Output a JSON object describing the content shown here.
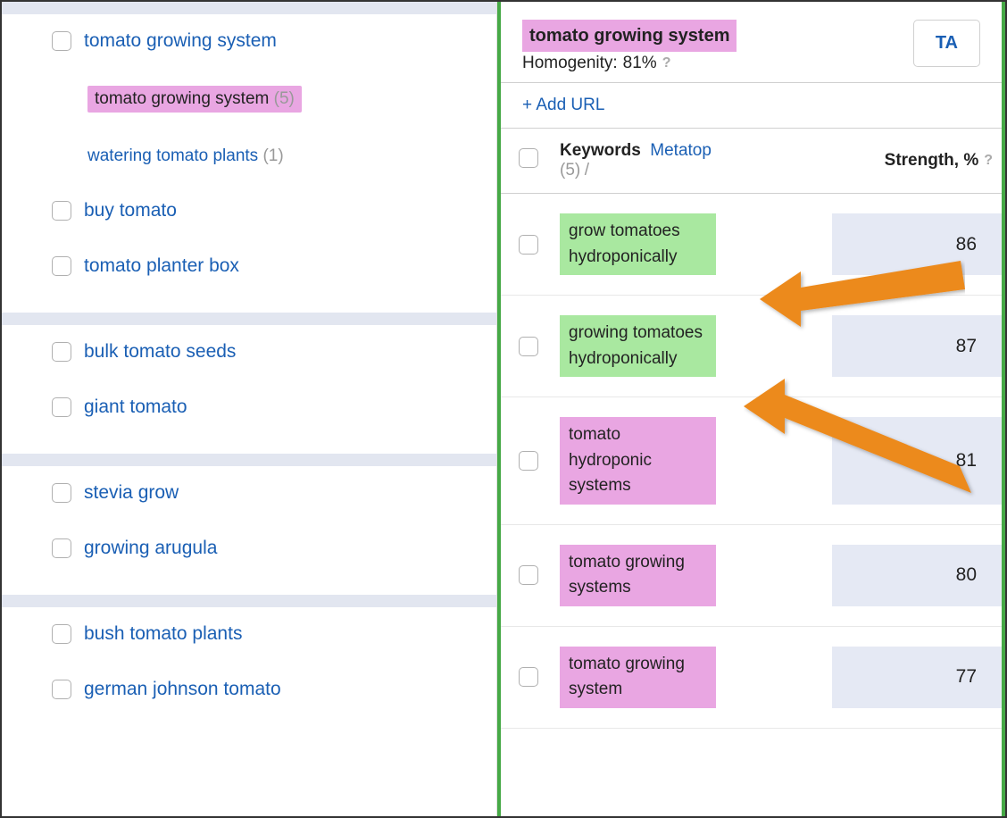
{
  "left": {
    "groups": [
      {
        "items": [
          {
            "label": "tomato growing system",
            "checkbox": true
          },
          {
            "nested": true,
            "highlighted": true,
            "label": "tomato growing system",
            "count": "(5)",
            "checkbox": false
          },
          {
            "nested": true,
            "label": "watering tomato plants",
            "count": "(1)",
            "checkbox": false
          },
          {
            "label": "buy tomato",
            "checkbox": true
          },
          {
            "label": "tomato planter box",
            "checkbox": true
          }
        ]
      },
      {
        "items": [
          {
            "label": "bulk tomato seeds",
            "checkbox": true
          },
          {
            "label": "giant tomato",
            "checkbox": true
          }
        ]
      },
      {
        "items": [
          {
            "label": "stevia grow",
            "checkbox": true
          },
          {
            "label": "growing arugula",
            "checkbox": true
          }
        ]
      },
      {
        "items": [
          {
            "label": "bush tomato plants",
            "checkbox": true
          },
          {
            "label": "german johnson tomato",
            "checkbox": true
          }
        ]
      }
    ]
  },
  "right": {
    "title": "tomato growing system",
    "homogeneity_label": "Homogenity:",
    "homogeneity_value": "81%",
    "ta_button": "TA",
    "add_url": "+ Add URL",
    "th_keywords": "Keywords",
    "th_count": "(5)",
    "th_metatop": "Metatop",
    "th_slash": " / ",
    "th_strength": "Strength, %",
    "rows": [
      {
        "keyword": "grow tomatoes hydroponically",
        "pill": "green",
        "strength": "86"
      },
      {
        "keyword": "growing tomatoes hydroponically",
        "pill": "green",
        "strength": "87"
      },
      {
        "keyword": "tomato hydroponic systems",
        "pill": "pink",
        "strength": "81"
      },
      {
        "keyword": "tomato growing systems",
        "pill": "pink",
        "strength": "80"
      },
      {
        "keyword": "tomato growing system",
        "pill": "pink",
        "strength": "77"
      }
    ]
  },
  "colors": {
    "link": "#1a5fb4",
    "highlight_pink": "#e9a6e2",
    "highlight_green": "#a9e8a0",
    "arrow": "#ec8a1f"
  }
}
